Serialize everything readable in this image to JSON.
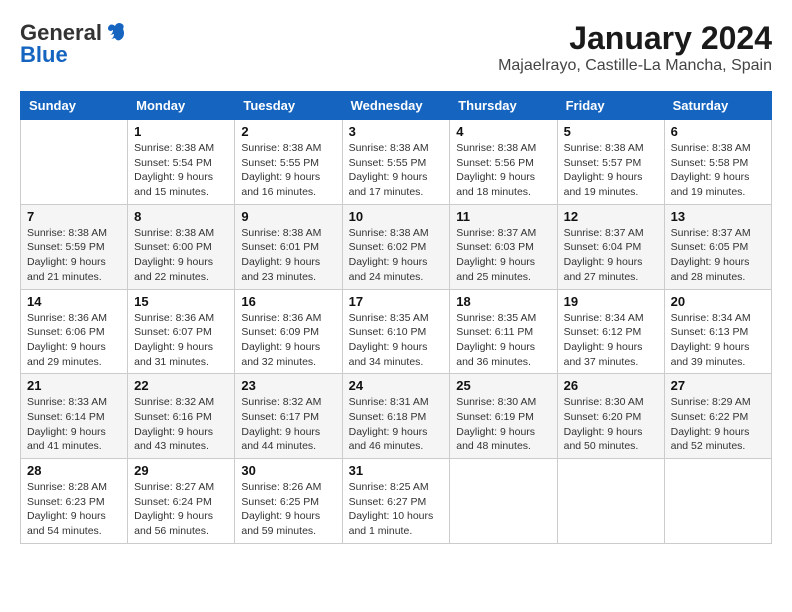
{
  "logo": {
    "general": "General",
    "blue": "Blue"
  },
  "title": "January 2024",
  "location": "Majaelrayo, Castille-La Mancha, Spain",
  "days_header": [
    "Sunday",
    "Monday",
    "Tuesday",
    "Wednesday",
    "Thursday",
    "Friday",
    "Saturday"
  ],
  "weeks": [
    [
      {
        "day": "",
        "sunrise": "",
        "sunset": "",
        "daylight": ""
      },
      {
        "day": "1",
        "sunrise": "Sunrise: 8:38 AM",
        "sunset": "Sunset: 5:54 PM",
        "daylight": "Daylight: 9 hours and 15 minutes."
      },
      {
        "day": "2",
        "sunrise": "Sunrise: 8:38 AM",
        "sunset": "Sunset: 5:55 PM",
        "daylight": "Daylight: 9 hours and 16 minutes."
      },
      {
        "day": "3",
        "sunrise": "Sunrise: 8:38 AM",
        "sunset": "Sunset: 5:55 PM",
        "daylight": "Daylight: 9 hours and 17 minutes."
      },
      {
        "day": "4",
        "sunrise": "Sunrise: 8:38 AM",
        "sunset": "Sunset: 5:56 PM",
        "daylight": "Daylight: 9 hours and 18 minutes."
      },
      {
        "day": "5",
        "sunrise": "Sunrise: 8:38 AM",
        "sunset": "Sunset: 5:57 PM",
        "daylight": "Daylight: 9 hours and 19 minutes."
      },
      {
        "day": "6",
        "sunrise": "Sunrise: 8:38 AM",
        "sunset": "Sunset: 5:58 PM",
        "daylight": "Daylight: 9 hours and 19 minutes."
      }
    ],
    [
      {
        "day": "7",
        "sunrise": "Sunrise: 8:38 AM",
        "sunset": "Sunset: 5:59 PM",
        "daylight": "Daylight: 9 hours and 21 minutes."
      },
      {
        "day": "8",
        "sunrise": "Sunrise: 8:38 AM",
        "sunset": "Sunset: 6:00 PM",
        "daylight": "Daylight: 9 hours and 22 minutes."
      },
      {
        "day": "9",
        "sunrise": "Sunrise: 8:38 AM",
        "sunset": "Sunset: 6:01 PM",
        "daylight": "Daylight: 9 hours and 23 minutes."
      },
      {
        "day": "10",
        "sunrise": "Sunrise: 8:38 AM",
        "sunset": "Sunset: 6:02 PM",
        "daylight": "Daylight: 9 hours and 24 minutes."
      },
      {
        "day": "11",
        "sunrise": "Sunrise: 8:37 AM",
        "sunset": "Sunset: 6:03 PM",
        "daylight": "Daylight: 9 hours and 25 minutes."
      },
      {
        "day": "12",
        "sunrise": "Sunrise: 8:37 AM",
        "sunset": "Sunset: 6:04 PM",
        "daylight": "Daylight: 9 hours and 27 minutes."
      },
      {
        "day": "13",
        "sunrise": "Sunrise: 8:37 AM",
        "sunset": "Sunset: 6:05 PM",
        "daylight": "Daylight: 9 hours and 28 minutes."
      }
    ],
    [
      {
        "day": "14",
        "sunrise": "Sunrise: 8:36 AM",
        "sunset": "Sunset: 6:06 PM",
        "daylight": "Daylight: 9 hours and 29 minutes."
      },
      {
        "day": "15",
        "sunrise": "Sunrise: 8:36 AM",
        "sunset": "Sunset: 6:07 PM",
        "daylight": "Daylight: 9 hours and 31 minutes."
      },
      {
        "day": "16",
        "sunrise": "Sunrise: 8:36 AM",
        "sunset": "Sunset: 6:09 PM",
        "daylight": "Daylight: 9 hours and 32 minutes."
      },
      {
        "day": "17",
        "sunrise": "Sunrise: 8:35 AM",
        "sunset": "Sunset: 6:10 PM",
        "daylight": "Daylight: 9 hours and 34 minutes."
      },
      {
        "day": "18",
        "sunrise": "Sunrise: 8:35 AM",
        "sunset": "Sunset: 6:11 PM",
        "daylight": "Daylight: 9 hours and 36 minutes."
      },
      {
        "day": "19",
        "sunrise": "Sunrise: 8:34 AM",
        "sunset": "Sunset: 6:12 PM",
        "daylight": "Daylight: 9 hours and 37 minutes."
      },
      {
        "day": "20",
        "sunrise": "Sunrise: 8:34 AM",
        "sunset": "Sunset: 6:13 PM",
        "daylight": "Daylight: 9 hours and 39 minutes."
      }
    ],
    [
      {
        "day": "21",
        "sunrise": "Sunrise: 8:33 AM",
        "sunset": "Sunset: 6:14 PM",
        "daylight": "Daylight: 9 hours and 41 minutes."
      },
      {
        "day": "22",
        "sunrise": "Sunrise: 8:32 AM",
        "sunset": "Sunset: 6:16 PM",
        "daylight": "Daylight: 9 hours and 43 minutes."
      },
      {
        "day": "23",
        "sunrise": "Sunrise: 8:32 AM",
        "sunset": "Sunset: 6:17 PM",
        "daylight": "Daylight: 9 hours and 44 minutes."
      },
      {
        "day": "24",
        "sunrise": "Sunrise: 8:31 AM",
        "sunset": "Sunset: 6:18 PM",
        "daylight": "Daylight: 9 hours and 46 minutes."
      },
      {
        "day": "25",
        "sunrise": "Sunrise: 8:30 AM",
        "sunset": "Sunset: 6:19 PM",
        "daylight": "Daylight: 9 hours and 48 minutes."
      },
      {
        "day": "26",
        "sunrise": "Sunrise: 8:30 AM",
        "sunset": "Sunset: 6:20 PM",
        "daylight": "Daylight: 9 hours and 50 minutes."
      },
      {
        "day": "27",
        "sunrise": "Sunrise: 8:29 AM",
        "sunset": "Sunset: 6:22 PM",
        "daylight": "Daylight: 9 hours and 52 minutes."
      }
    ],
    [
      {
        "day": "28",
        "sunrise": "Sunrise: 8:28 AM",
        "sunset": "Sunset: 6:23 PM",
        "daylight": "Daylight: 9 hours and 54 minutes."
      },
      {
        "day": "29",
        "sunrise": "Sunrise: 8:27 AM",
        "sunset": "Sunset: 6:24 PM",
        "daylight": "Daylight: 9 hours and 56 minutes."
      },
      {
        "day": "30",
        "sunrise": "Sunrise: 8:26 AM",
        "sunset": "Sunset: 6:25 PM",
        "daylight": "Daylight: 9 hours and 59 minutes."
      },
      {
        "day": "31",
        "sunrise": "Sunrise: 8:25 AM",
        "sunset": "Sunset: 6:27 PM",
        "daylight": "Daylight: 10 hours and 1 minute."
      },
      {
        "day": "",
        "sunrise": "",
        "sunset": "",
        "daylight": ""
      },
      {
        "day": "",
        "sunrise": "",
        "sunset": "",
        "daylight": ""
      },
      {
        "day": "",
        "sunrise": "",
        "sunset": "",
        "daylight": ""
      }
    ]
  ]
}
